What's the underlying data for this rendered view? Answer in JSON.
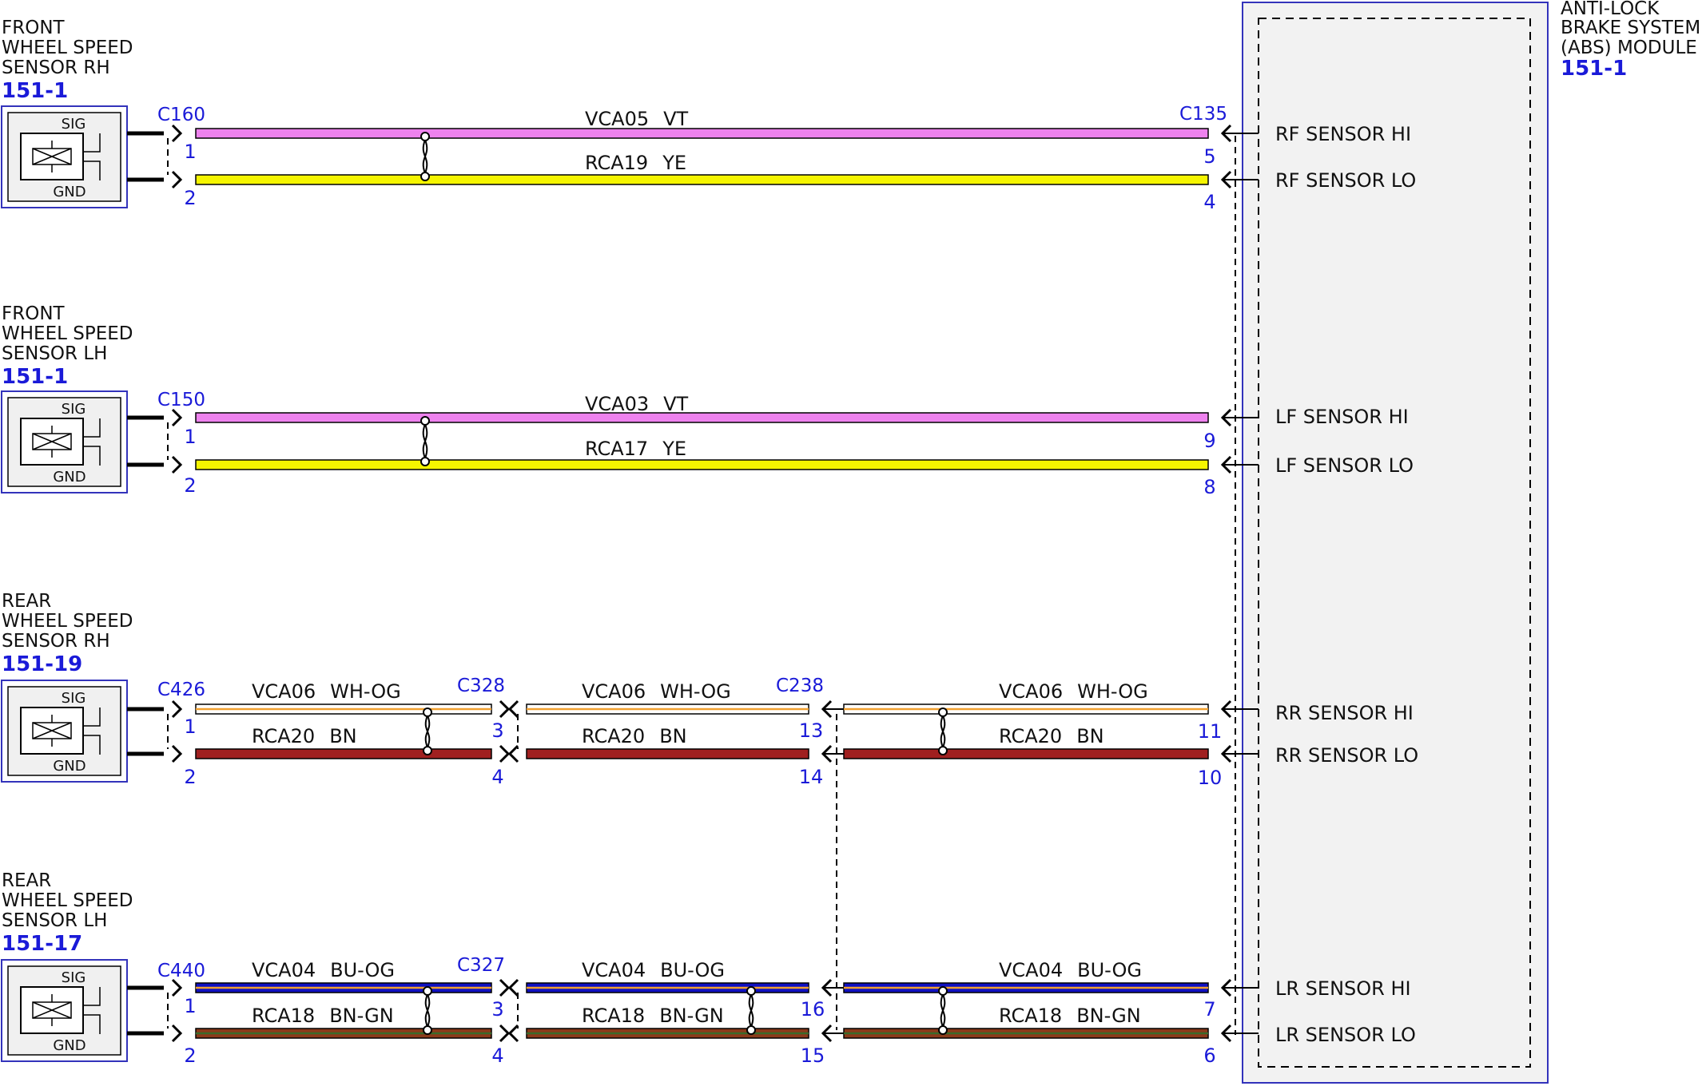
{
  "abs_module": {
    "title_lines": [
      "ANTI-LOCK",
      "BRAKE SYSTEM",
      "(ABS) MODULE"
    ],
    "ref": "151-1",
    "connector": "C135",
    "pins": [
      {
        "num": "5",
        "label": "RF SENSOR HI"
      },
      {
        "num": "4",
        "label": "RF SENSOR LO"
      },
      {
        "num": "9",
        "label": "LF SENSOR HI"
      },
      {
        "num": "8",
        "label": "LF SENSOR LO"
      },
      {
        "num": "11",
        "label": "RR SENSOR HI"
      },
      {
        "num": "10",
        "label": "RR SENSOR LO"
      },
      {
        "num": "7",
        "label": "LR SENSOR HI"
      },
      {
        "num": "6",
        "label": "LR SENSOR LO"
      }
    ]
  },
  "sensors": [
    {
      "title_lines": [
        "FRONT",
        "WHEEL SPEED",
        "SENSOR RH"
      ],
      "ref": "151-1",
      "connector": "C160",
      "sig": "SIG",
      "gnd": "GND",
      "pin_hi": "1",
      "pin_lo": "2"
    },
    {
      "title_lines": [
        "FRONT",
        "WHEEL SPEED",
        "SENSOR LH"
      ],
      "ref": "151-1",
      "connector": "C150",
      "sig": "SIG",
      "gnd": "GND",
      "pin_hi": "1",
      "pin_lo": "2"
    },
    {
      "title_lines": [
        "REAR",
        "WHEEL SPEED",
        "SENSOR RH"
      ],
      "ref": "151-19",
      "connector": "C426",
      "sig": "SIG",
      "gnd": "GND",
      "pin_hi": "1",
      "pin_lo": "2"
    },
    {
      "title_lines": [
        "REAR",
        "WHEEL SPEED",
        "SENSOR LH"
      ],
      "ref": "151-17",
      "connector": "C440",
      "sig": "SIG",
      "gnd": "GND",
      "pin_hi": "1",
      "pin_lo": "2"
    }
  ],
  "inline_connectors": [
    {
      "name": "C328",
      "pin_hi": "3",
      "pin_lo": "4"
    },
    {
      "name": "C238",
      "pin_hi": "13",
      "pin_lo": "14"
    },
    {
      "name": "C327",
      "pin_hi": "3",
      "pin_lo": "4"
    },
    {
      "name": "C238",
      "pin_hi": "16",
      "pin_lo": "15"
    }
  ],
  "wires": [
    {
      "circuit": "VCA05",
      "color_code": "VT",
      "color": "#ee82ee"
    },
    {
      "circuit": "RCA19",
      "color_code": "YE",
      "color": "#f5f500"
    },
    {
      "circuit": "VCA03",
      "color_code": "VT",
      "color": "#ee82ee"
    },
    {
      "circuit": "RCA17",
      "color_code": "YE",
      "color": "#f5f500"
    },
    {
      "circuit": "VCA06",
      "color_code": "WH-OG",
      "color": "#ffffff",
      "stripe": "#f0a030"
    },
    {
      "circuit": "RCA20",
      "color_code": "BN",
      "color": "#a02020"
    },
    {
      "circuit": "VCA04",
      "color_code": "BU-OG",
      "color": "#1010c0",
      "stripe": "#f0a030"
    },
    {
      "circuit": "RCA18",
      "color_code": "BN-GN",
      "color": "#8b3a1a",
      "stripe": "#3a6a2a"
    }
  ]
}
